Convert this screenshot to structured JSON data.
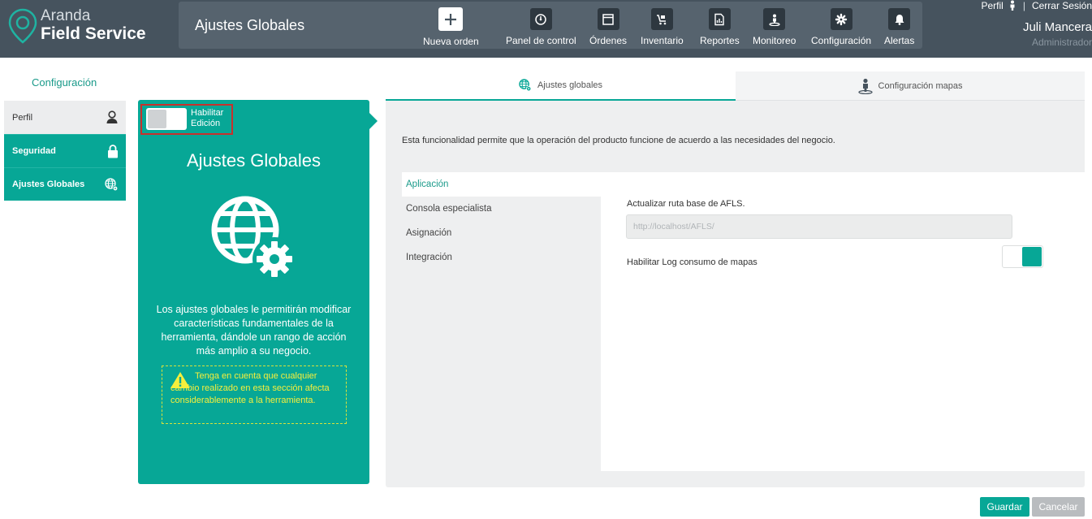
{
  "app": {
    "brand_line1": "Aranda",
    "brand_line2": "Field Service",
    "page_title": "Ajustes Globales"
  },
  "nav": [
    {
      "label": "Nueva orden",
      "icon": "plus-icon"
    },
    {
      "label": "Panel de control",
      "icon": "dashboard-icon"
    },
    {
      "label": "Órdenes",
      "icon": "orders-icon"
    },
    {
      "label": "Inventario",
      "icon": "cart-icon"
    },
    {
      "label": "Reportes",
      "icon": "report-icon"
    },
    {
      "label": "Monitoreo",
      "icon": "person-pin-icon"
    },
    {
      "label": "Configuración",
      "icon": "gear-icon"
    },
    {
      "label": "Alertas",
      "icon": "bell-icon"
    }
  ],
  "user": {
    "profile_link": "Perfil",
    "logout_link": "Cerrar Sesión",
    "name": "Juli Mancera",
    "role": "Administrador"
  },
  "sidebar": {
    "title": "Configuración",
    "items": [
      {
        "label": "Perfil",
        "icon": "user-icon"
      },
      {
        "label": "Seguridad",
        "icon": "lock-icon"
      },
      {
        "label": "Ajustes Globales",
        "icon": "globe-gear-icon"
      }
    ]
  },
  "card": {
    "edit_toggle_label": "Habilitar Edición",
    "edit_enabled": false,
    "title": "Ajustes Globales",
    "description": "Los ajustes globales le permitirán modificar características fundamentales de la herramienta, dándole un rango de acción más amplio a su negocio.",
    "warning": "Tenga en cuenta que cualquier cambio realizado en esta sección afecta considerablemente a la herramienta."
  },
  "tabs": [
    {
      "label": "Ajustes globales",
      "icon": "globe-gear-icon",
      "active": true
    },
    {
      "label": "Configuración mapas",
      "icon": "person-pin-icon",
      "active": false
    }
  ],
  "content": {
    "description": "Esta funcionalidad permite que la operación del producto funcione de acuerdo a las necesidades del negocio.",
    "subnav": [
      {
        "label": "Aplicación",
        "active": true
      },
      {
        "label": "Consola especialista",
        "active": false
      },
      {
        "label": "Asignación",
        "active": false
      },
      {
        "label": "Integración",
        "active": false
      }
    ],
    "url_label": "Actualizar ruta base de AFLS.",
    "url_value": "http://localhost/AFLS/",
    "map_log_label": "Habilitar Log consumo de mapas",
    "map_log_enabled": true
  },
  "buttons": {
    "save": "Guardar",
    "cancel": "Cancelar"
  },
  "colors": {
    "accent": "#07a796",
    "topbar": "#46535e",
    "warning": "#f6ef3c"
  }
}
